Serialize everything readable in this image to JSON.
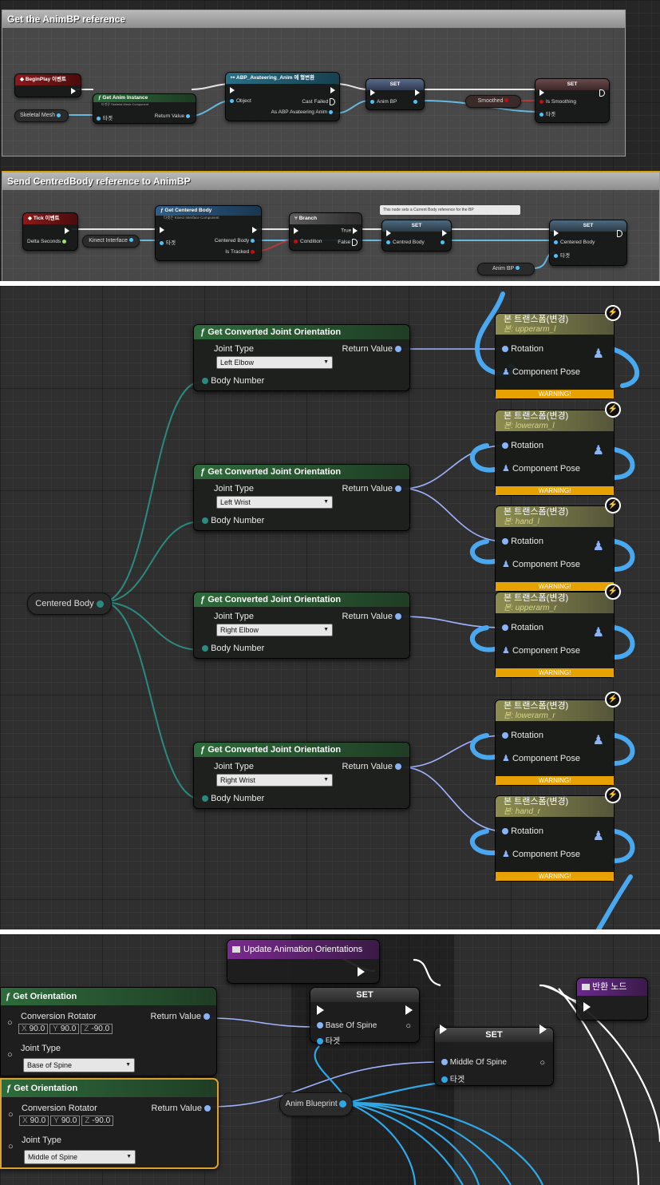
{
  "panel1": {
    "comment1_title": "Get the AnimBP reference",
    "begin_play": "BeginPlay 이벤트",
    "skeletal_mesh": "Skeletal Mesh",
    "get_anim_instance": "Get Anim Instance",
    "get_anim_instance_sub": "타겟은 Skeletal Mesh Component",
    "target": "타겟",
    "return_value": "Return Value",
    "cast_title": "ABP_Avateering_Anim 에 형변환",
    "object": "Object",
    "cast_failed": "Cast Failed",
    "as_abp": "As ABP Avateering Anim",
    "set": "SET",
    "anim_bp_pin": "Anim BP",
    "smoothed": "Smoothed",
    "is_smoothing": "Is Smoothing",
    "comment2_title": "Send CentredBody reference to AnimBP",
    "tick": "Tick 이벤트",
    "delta_seconds": "Delta Seconds",
    "kinect_interface": "Kinect Interface",
    "get_centered_body": "Get Centered Body",
    "get_centered_body_sub": "타겟은 Kinect Interface Component",
    "centered_body": "Centered Body",
    "is_tracked": "Is Tracked",
    "branch": "Branch",
    "condition": "Condition",
    "true_label": "True",
    "false_label": "False",
    "tooltip": "This node sets a Current Body reference for the BP",
    "centred_body": "Centred Body",
    "anim_bp": "Anim BP"
  },
  "panel2": {
    "centered_body": "Centered Body",
    "func_title": "Get Converted Joint Orientation",
    "joint_type": "Joint Type",
    "body_number": "Body Number",
    "return_value": "Return Value",
    "joints": [
      "Left Elbow",
      "Left Wrist",
      "Right Elbow",
      "Right Wrist"
    ],
    "bone_title": "본 트랜스폼(변경)",
    "bones": [
      "본: upperarm_l",
      "본: lowerarm_l",
      "본: hand_l",
      "본: upperarm_r",
      "본: lowerarm_r",
      "본: hand_r"
    ],
    "rotation": "Rotation",
    "component_pose": "Component Pose",
    "warning": "WARNING!"
  },
  "panel3": {
    "update_event": "Update Animation Orientations",
    "get_orientation": "Get Orientation",
    "conversion_rotator": "Conversion Rotator",
    "return_value": "Return Value",
    "joint_type": "Joint Type",
    "joint1": "Base of Spine",
    "joint2": "Middle of Spine",
    "rot_x": "90.0",
    "rot_y": "90.0",
    "rot_z": "-90.0",
    "x": "X",
    "y": "Y",
    "z": "Z",
    "set": "SET",
    "base_of_spine": "Base Of Spine",
    "middle_of_spine": "Middle Of Spine",
    "target": "타겟",
    "anim_blueprint": "Anim Blueprint",
    "return_node": "반환 노드"
  },
  "colors": {
    "exec_white": "#ffffff",
    "object_pin": "#4fc3f7",
    "struct_pin": "#8ab4f8",
    "function_header": "#2e6b3a",
    "warning": "#e8a200",
    "event_header": "#8b1a1a",
    "return_node_header": "#6a2a8a"
  }
}
